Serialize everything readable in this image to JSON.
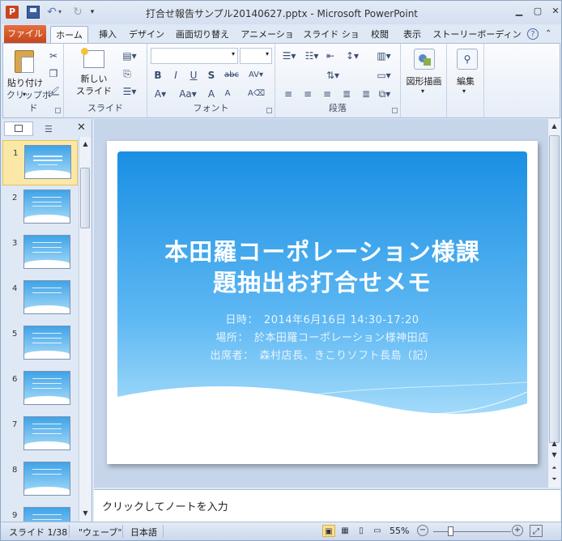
{
  "titlebar": {
    "title": "打合せ報告サンプル20140627.pptx  -  Microsoft PowerPoint",
    "app_icon": "P"
  },
  "tabs": {
    "file": "ファイル",
    "items": [
      "ホーム",
      "挿入",
      "デザイン",
      "画面切り替え",
      "アニメーション",
      "スライド ショー",
      "校閲",
      "表示",
      "ストーリーボーディング"
    ]
  },
  "ribbon": {
    "clipboard": {
      "paste": "貼り付け",
      "label": "クリップボード"
    },
    "slides": {
      "new_slide": "新しい\nスライド",
      "label": "スライド"
    },
    "font": {
      "label": "フォント"
    },
    "paragraph": {
      "label": "段落"
    },
    "drawing": {
      "label": "図形描画"
    },
    "editing": {
      "label": "編集"
    }
  },
  "slides_panel": {
    "numbers": [
      "1",
      "2",
      "3",
      "4",
      "5",
      "6",
      "7",
      "8",
      "9"
    ],
    "selected": 1
  },
  "slide": {
    "title": "本田羅コーポレーション様課題抽出お打合せメモ",
    "title_line1": "本田羅コーポレーション様課",
    "title_line2": "題抽出お打合せメモ",
    "line1": "日時：　2014年6月16日 14:30-17:20",
    "line2": "場所：　於本田羅コーポレーション様神田店",
    "line3": "出席者：　森村店長、きこりソフト長島（記）"
  },
  "notes": {
    "placeholder": "クリックしてノートを入力"
  },
  "status": {
    "slide": "スライド 1/38",
    "theme": "\"ウェーブ\"",
    "language": "日本語",
    "zoom": "55%"
  }
}
